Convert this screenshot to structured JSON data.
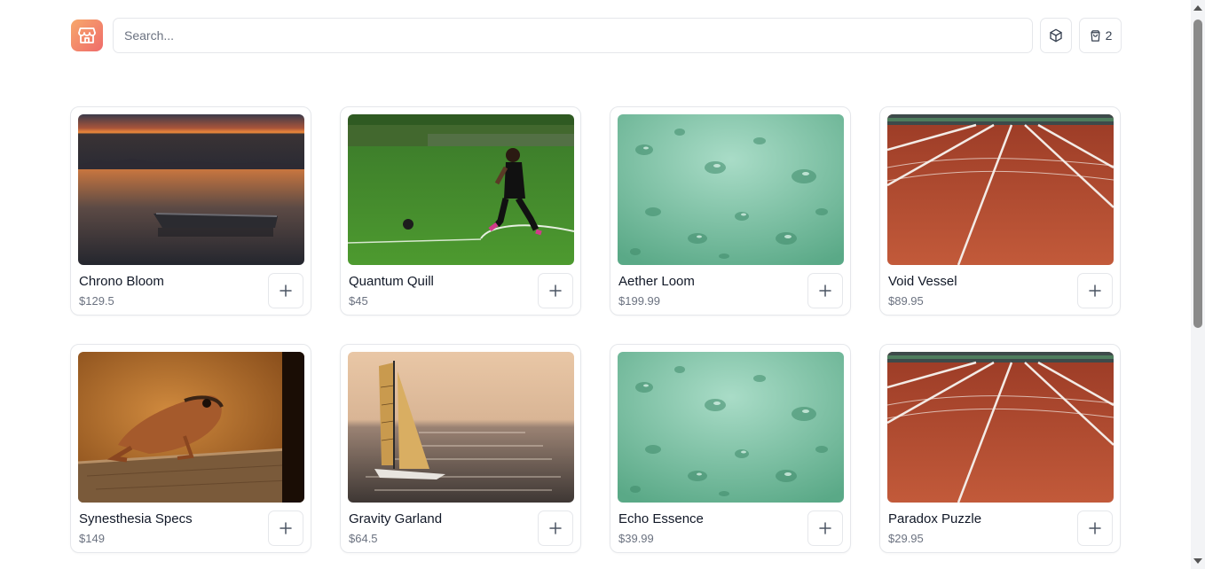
{
  "header": {
    "logo_icon": "storefront-icon",
    "search": {
      "placeholder": "Search...",
      "value": ""
    },
    "box_button_icon": "package-icon",
    "cart": {
      "icon": "shopping-bag-icon",
      "count": "2"
    }
  },
  "colors": {
    "logo_gradient_start": "#f7a86b",
    "logo_gradient_end": "#ef6b6b",
    "border": "#e5e7eb",
    "price_text": "#6b7280"
  },
  "products": [
    {
      "name": "Chrono Bloom",
      "price": "$129.5",
      "image": "sunset-lake-rowboat"
    },
    {
      "name": "Quantum Quill",
      "price": "$45",
      "image": "child-playing-soccer"
    },
    {
      "name": "Aether Loom",
      "price": "$199.99",
      "image": "water-droplets-green"
    },
    {
      "name": "Void Vessel",
      "price": "$89.95",
      "image": "running-track"
    },
    {
      "name": "Synesthesia Specs",
      "price": "$149",
      "image": "frog-on-stump"
    },
    {
      "name": "Gravity Garland",
      "price": "$64.5",
      "image": "sailboat-at-sea"
    },
    {
      "name": "Echo Essence",
      "price": "$39.99",
      "image": "water-droplets-green"
    },
    {
      "name": "Paradox Puzzle",
      "price": "$29.95",
      "image": "running-track"
    }
  ],
  "add_button_icon": "plus-icon"
}
